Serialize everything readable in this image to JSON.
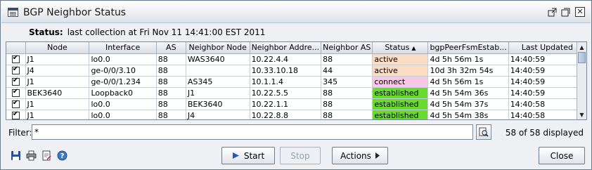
{
  "window": {
    "title": "BGP Neighbor Status"
  },
  "status": {
    "label": "Status:",
    "text": "last collection at Fri Nov 11 14:41:00 EST 2011"
  },
  "table": {
    "columns": [
      "",
      "Node",
      "Interface",
      "AS",
      "Neighbor Node",
      "Neighbor Addre...",
      "Neighbor AS",
      "Status",
      "bgpPeerFsmEstab...",
      "Last Updated"
    ],
    "sorted_column": "Status",
    "rows": [
      {
        "checked": true,
        "node": "J1",
        "interface": "lo0.0",
        "as": "88",
        "neighbor_node": "WAS3640",
        "neighbor_address": "10.22.4.4",
        "neighbor_as": "88",
        "status": "active",
        "established": "4d 5h 56m 1s",
        "last_updated": "14:40:59"
      },
      {
        "checked": true,
        "node": "J4",
        "interface": "ge-0/0/3.10",
        "as": "88",
        "neighbor_node": "",
        "neighbor_address": "10.33.10.18",
        "neighbor_as": "44",
        "status": "active",
        "established": "10d 3h 32m 54s",
        "last_updated": "14:40:59"
      },
      {
        "checked": true,
        "node": "J1",
        "interface": "ge-0/0/1.234",
        "as": "88",
        "neighbor_node": "AS345",
        "neighbor_address": "10.1.1.4",
        "neighbor_as": "345",
        "status": "connect",
        "established": "4d 5h 56m 1s",
        "last_updated": "14:40:59"
      },
      {
        "checked": true,
        "node": "BEK3640",
        "interface": "Loopback0",
        "as": "88",
        "neighbor_node": "J1",
        "neighbor_address": "10.22.5.5",
        "neighbor_as": "88",
        "status": "established",
        "established": "4d 5h 54m 36s",
        "last_updated": "14:40:59"
      },
      {
        "checked": true,
        "node": "J1",
        "interface": "lo0.0",
        "as": "88",
        "neighbor_node": "BEK3640",
        "neighbor_address": "10.22.1.1",
        "neighbor_as": "88",
        "status": "established",
        "established": "4d 5h 54m 37s",
        "last_updated": "14:40:58"
      },
      {
        "checked": true,
        "node": "J1",
        "interface": "lo0.0",
        "as": "88",
        "neighbor_node": "J4",
        "neighbor_address": "10.22.8.8",
        "neighbor_as": "88",
        "status": "established",
        "established": "4d 5h 54m 38s",
        "last_updated": "14:40:58"
      }
    ]
  },
  "status_colors": {
    "active": "#fddcc4",
    "connect": "#f9c7e6",
    "established": "#66dd2e"
  },
  "filter": {
    "label": "Filter:",
    "value": "*",
    "count_text": "58 of 58 displayed"
  },
  "toolbar": {
    "icons": [
      "save-icon",
      "print-icon",
      "export-icon",
      "help-icon"
    ],
    "start_label": "Start",
    "stop_label": "Stop",
    "actions_label": "Actions",
    "close_label": "Close"
  }
}
